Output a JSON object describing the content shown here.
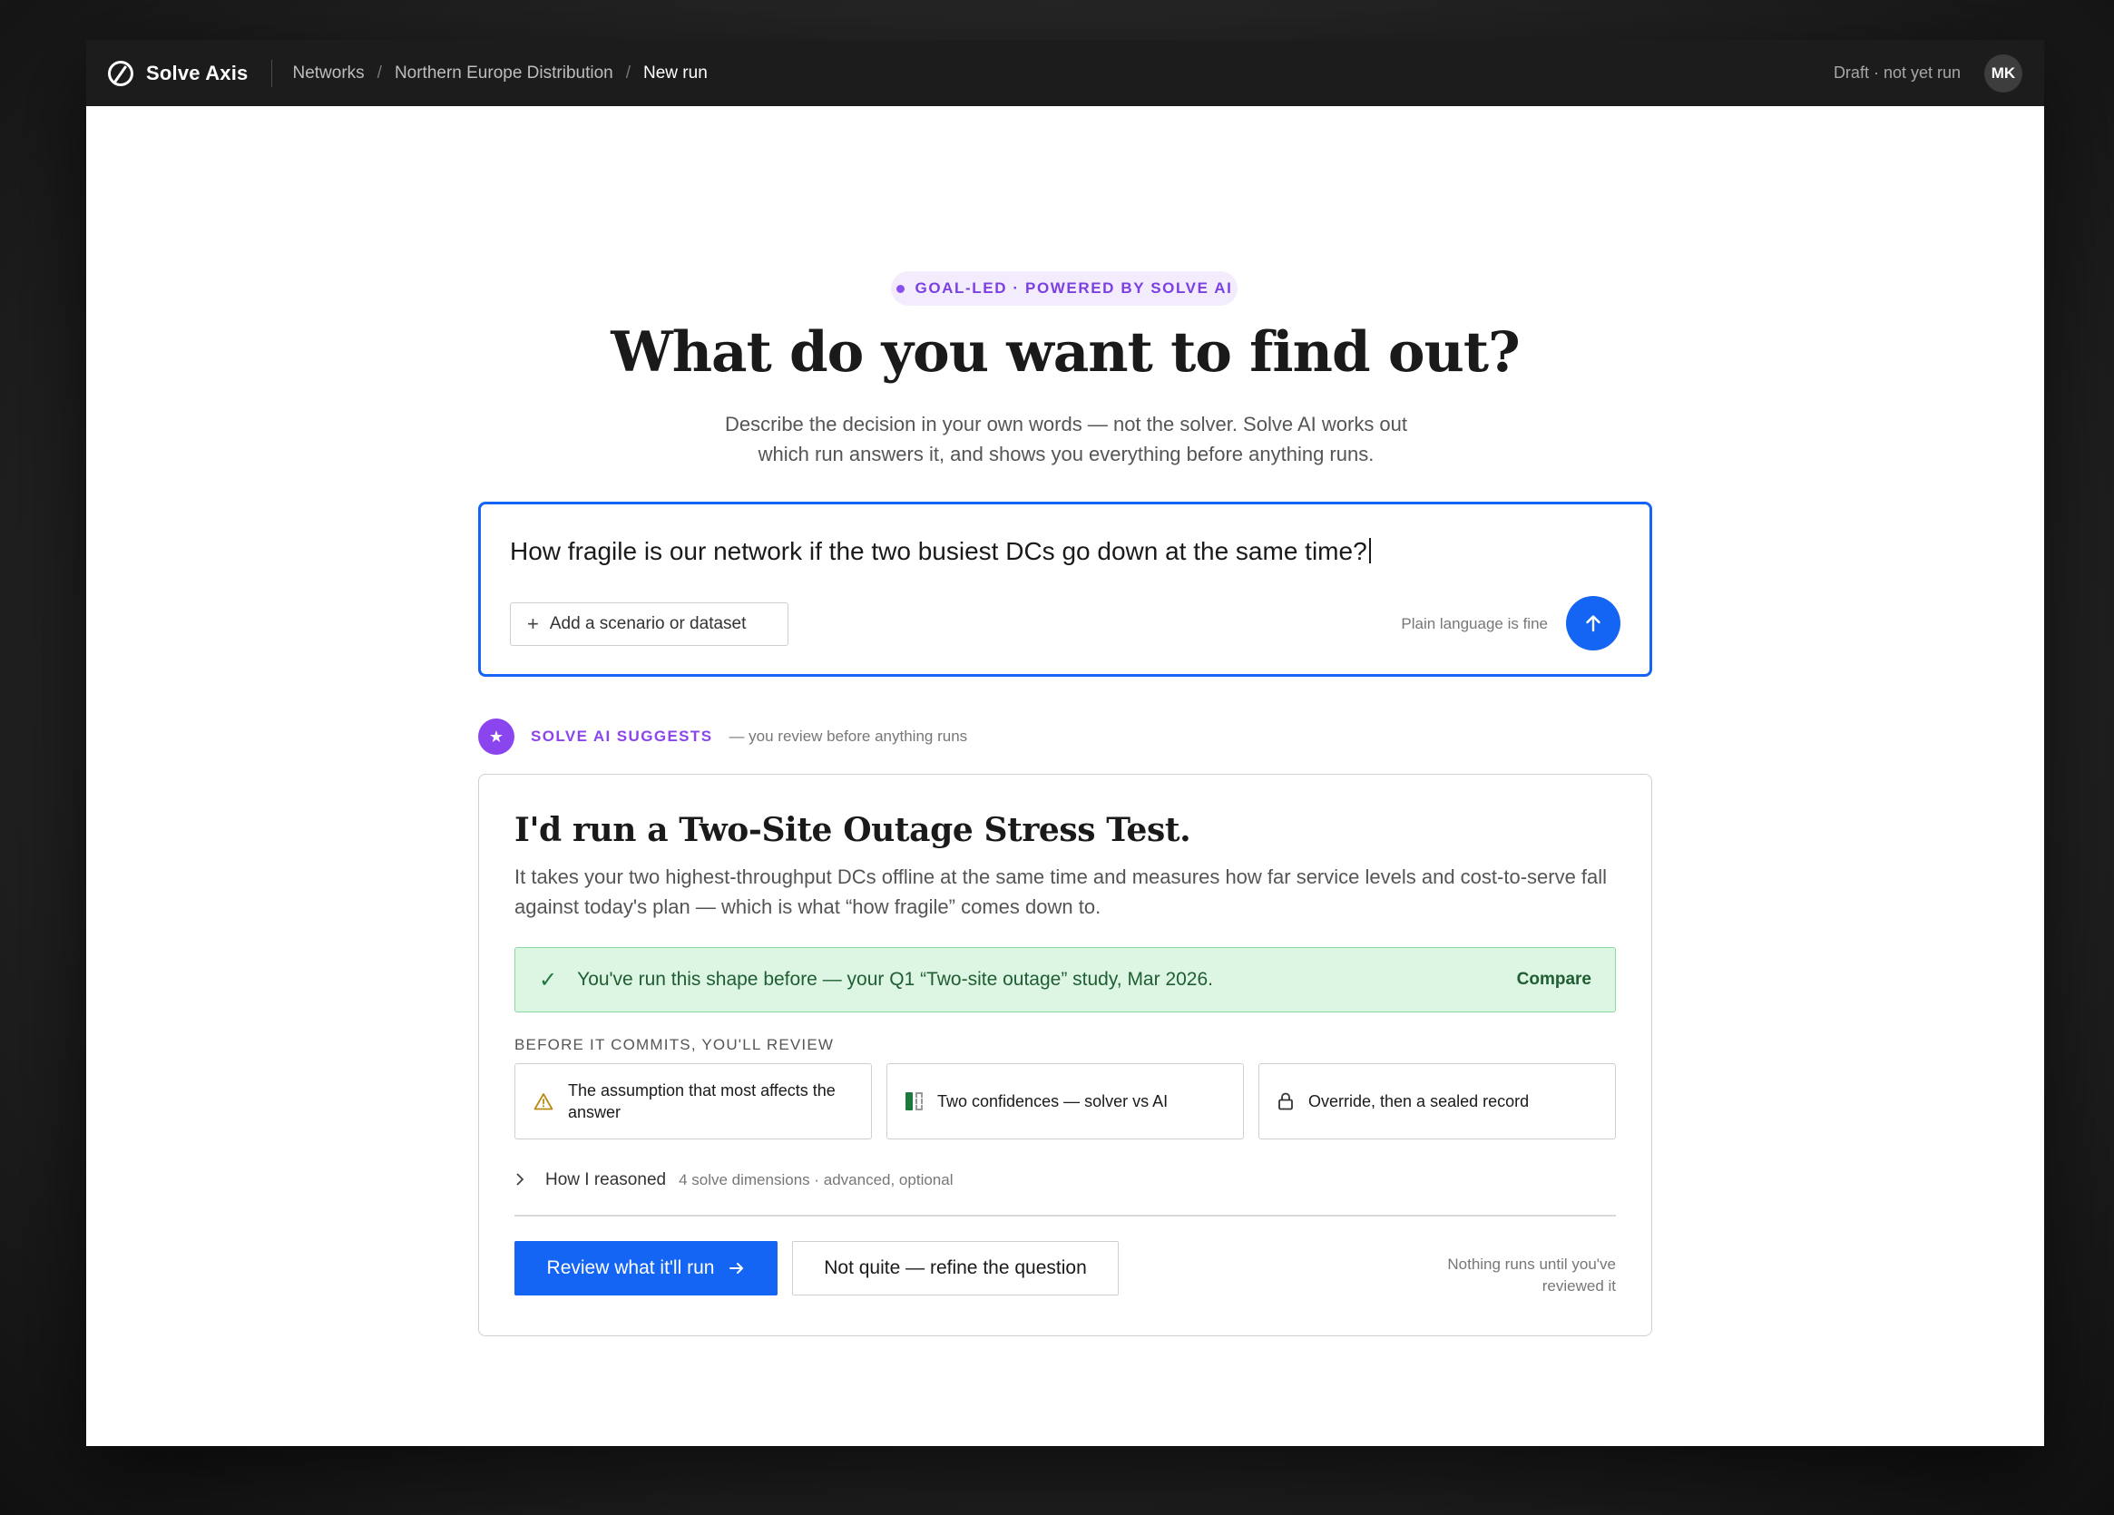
{
  "app": {
    "name": "Solve Axis"
  },
  "breadcrumbs": [
    {
      "label": "Networks"
    },
    {
      "label": "Northern Europe Distribution"
    },
    {
      "label": "New run"
    }
  ],
  "breadcrumb_separator": "/",
  "header": {
    "status": "Draft · not yet run",
    "avatar_initials": "MK"
  },
  "hero": {
    "pill": "GOAL-LED · POWERED BY SOLVE AI",
    "title": "What do you want to find out?",
    "subtitle_line1": "Describe the decision in your own words — not the solver. Solve AI works out",
    "subtitle_line2": "which run answers it, and shows you everything before anything runs."
  },
  "composer": {
    "query": "How fragile is our network if the two busiest DCs go down at the same time?",
    "add_button": "Add a scenario or dataset",
    "hint": "Plain language is fine",
    "send_icon": "arrow-up-icon"
  },
  "suggestion": {
    "label": "SOLVE AI SUGGESTS",
    "note": "— you review before anything runs",
    "title": "I'd run a Two-Site Outage Stress Test.",
    "description": "It takes your two highest-throughput DCs offline at the same time and measures how far service levels and cost-to-serve fall against today's plan — which is what “how fragile” comes down to.",
    "banner": {
      "text": "You've run this shape before — your Q1 “Two-site outage” study, Mar 2026.",
      "action": "Compare"
    },
    "review_label": "BEFORE IT COMMITS, YOU'LL REVIEW",
    "review_items": [
      {
        "label": "The assumption that most affects the answer",
        "icon": "warning-icon"
      },
      {
        "label": "Two confidences — solver vs AI",
        "icon": "confidence-bars-icon"
      },
      {
        "label": "Override, then a sealed record",
        "icon": "lock-icon"
      }
    ],
    "reasoning": {
      "title": "How I reasoned",
      "note": "4 solve dimensions · advanced, optional"
    },
    "primary_action": "Review what it'll run",
    "secondary_action": "Not quite — refine the question",
    "footer_note": "Nothing runs until you've reviewed it"
  },
  "colors": {
    "accent": "#1565f4",
    "ai_purple": "#8a45ee",
    "success_bg": "#ddf6e3",
    "success_text": "#1f5d32"
  }
}
